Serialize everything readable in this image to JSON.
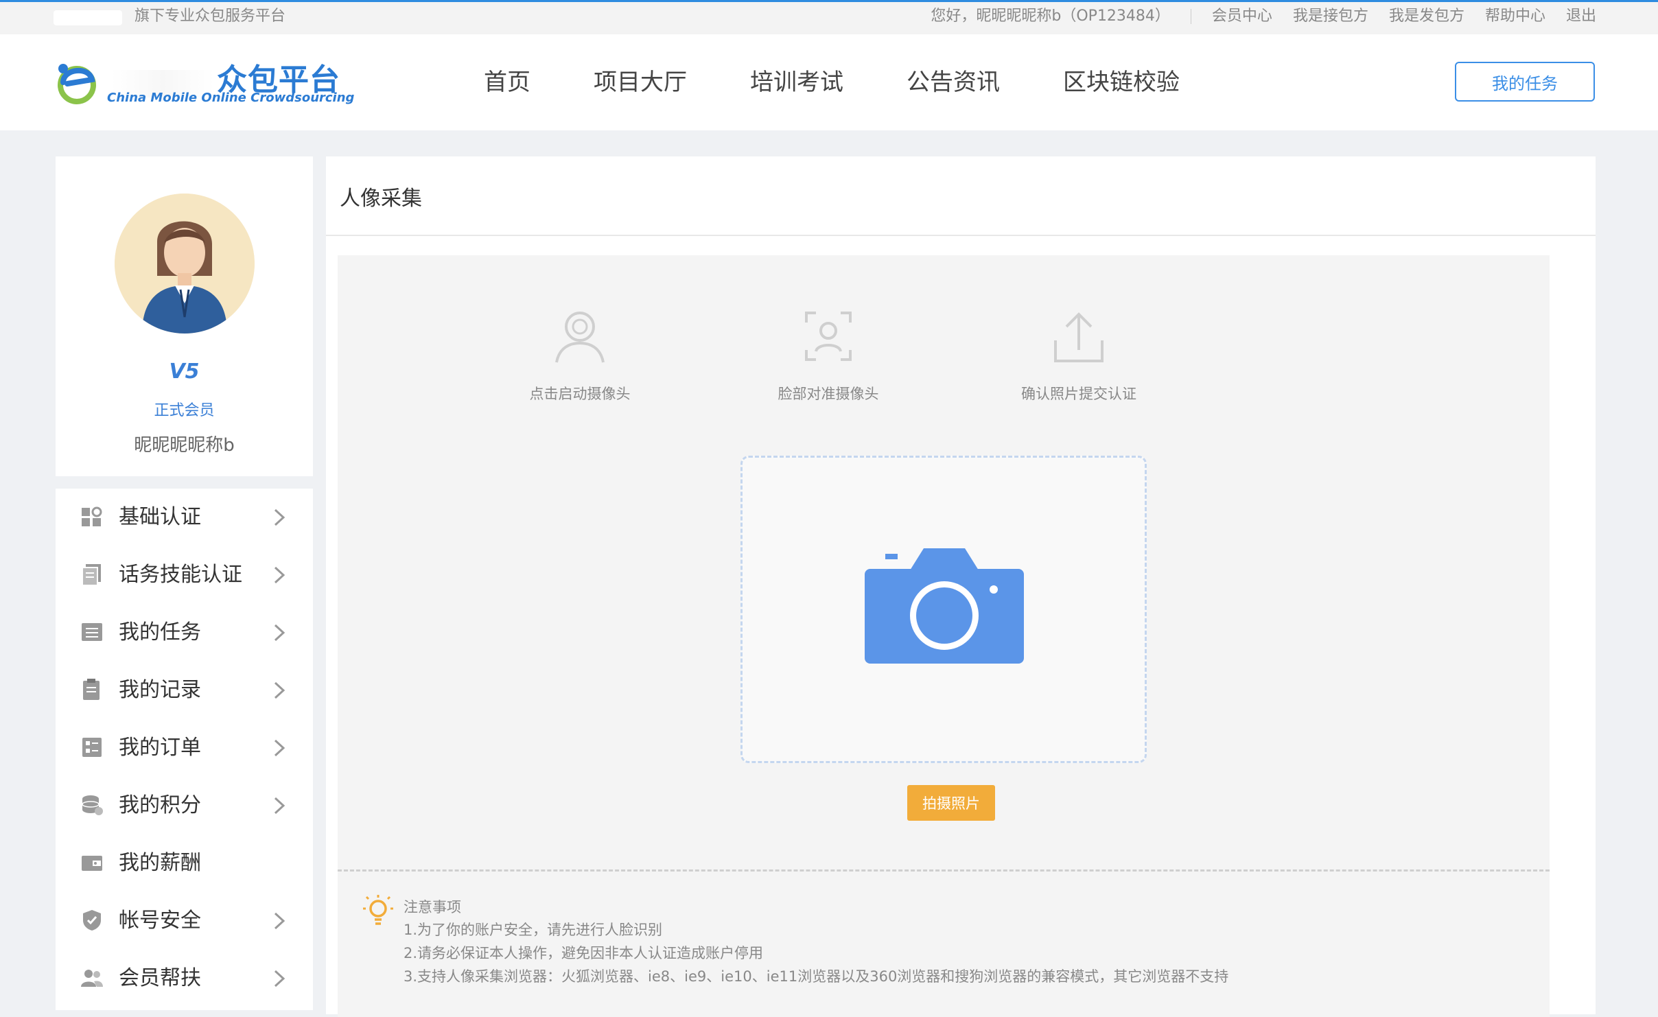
{
  "topbar": {
    "slogan": "旗下专业众包服务平台",
    "greeting": "您好，昵昵昵昵称b（OP123484）",
    "links": [
      "会员中心",
      "我是接包方",
      "我是发包方",
      "帮助中心",
      "退出"
    ]
  },
  "header": {
    "logo_title": "众包平台",
    "logo_subtitle": "China Mobile Online Crowdsourcing",
    "nav": [
      "首页",
      "项目大厅",
      "培训考试",
      "公告资讯",
      "区块链校验"
    ],
    "my_task_button": "我的任务"
  },
  "profile": {
    "level": "V5",
    "member_type": "正式会员",
    "nickname": "昵昵昵昵称b"
  },
  "menu": {
    "items": [
      {
        "label": "基础认证",
        "icon": "grid-id-icon",
        "arrow": true
      },
      {
        "label": "话务技能认证",
        "icon": "document-icon",
        "arrow": true
      },
      {
        "label": "我的任务",
        "icon": "task-list-icon",
        "arrow": true
      },
      {
        "label": "我的记录",
        "icon": "record-icon",
        "arrow": true
      },
      {
        "label": "我的订单",
        "icon": "order-icon",
        "arrow": true
      },
      {
        "label": "我的积分",
        "icon": "coins-icon",
        "arrow": true
      },
      {
        "label": "我的薪酬",
        "icon": "wallet-icon",
        "arrow": false
      },
      {
        "label": "帐号安全",
        "icon": "shield-icon",
        "arrow": true
      },
      {
        "label": "会员帮扶",
        "icon": "users-icon",
        "arrow": true
      }
    ]
  },
  "main": {
    "title": "人像采集",
    "steps": [
      {
        "label": "点击启动摄像头",
        "icon": "person-icon"
      },
      {
        "label": "脸部对准摄像头",
        "icon": "face-frame-icon"
      },
      {
        "label": "确认照片提交认证",
        "icon": "upload-icon"
      }
    ],
    "shoot_button": "拍摄照片",
    "notes": {
      "title": "注意事项",
      "lines": [
        "1.为了你的账户安全，请先进行人脸识别",
        "2.请务必保证本人操作，避免因非本人认证造成账户停用",
        "3.支持人像采集浏览器：火狐浏览器、ie8、ie9、ie10、ie11浏览器以及360浏览器和搜狗浏览器的兼容模式，其它浏览器不支持"
      ]
    }
  },
  "colors": {
    "accent": "#3a8ee6",
    "camera": "#5b95e8",
    "shoot_button": "#f2ac3a",
    "brand": "#2b7bd3"
  }
}
